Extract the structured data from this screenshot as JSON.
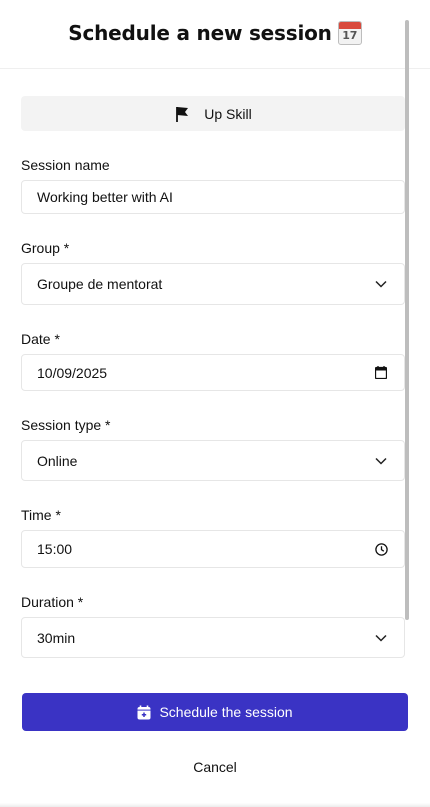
{
  "header": {
    "title": "Schedule a new session",
    "calendar_emoji_day": "17"
  },
  "skill": {
    "label": "Up Skill",
    "icon": "flag-icon"
  },
  "form": {
    "session_name": {
      "label": "Session name",
      "value": "Working better with AI"
    },
    "group": {
      "label": "Group *",
      "value": "Groupe de mentorat"
    },
    "date": {
      "label": "Date *",
      "value": "10/09/2025"
    },
    "session_type": {
      "label": "Session type *",
      "value": "Online"
    },
    "time": {
      "label": "Time *",
      "value": "15:00"
    },
    "duration": {
      "label": "Duration *",
      "value": "30min"
    }
  },
  "actions": {
    "primary_label": "Schedule the session",
    "cancel_label": "Cancel"
  },
  "colors": {
    "primary": "#3a33c4",
    "field_border": "#e6e6e6",
    "skill_bg": "#f3f3f3"
  }
}
